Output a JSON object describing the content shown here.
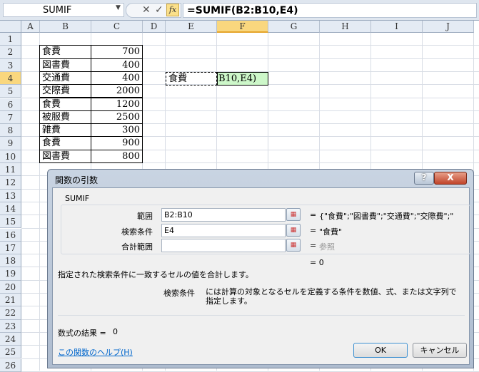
{
  "formula_bar": {
    "name_box": "SUMIF",
    "cancel_icon": "✕",
    "enter_icon": "✓",
    "fx": "fx",
    "formula": "=SUMIF(B2:B10,E4)"
  },
  "columns": [
    "A",
    "B",
    "C",
    "D",
    "E",
    "F",
    "G",
    "H",
    "I",
    "J"
  ],
  "selected_column": "F",
  "rows": [
    "1",
    "2",
    "3",
    "4",
    "5",
    "6",
    "7",
    "8",
    "9",
    "10",
    "11",
    "12",
    "13",
    "14",
    "15",
    "16",
    "17",
    "18",
    "19",
    "20",
    "21",
    "22",
    "23",
    "24",
    "25",
    "26"
  ],
  "selected_row": "4",
  "table": [
    {
      "item": "食費",
      "amount": "700"
    },
    {
      "item": "図書費",
      "amount": "400"
    },
    {
      "item": "交通費",
      "amount": "400"
    },
    {
      "item": "交際費",
      "amount": "2000"
    },
    {
      "item": "食費",
      "amount": "1200"
    },
    {
      "item": "被服費",
      "amount": "2500"
    },
    {
      "item": "雑費",
      "amount": "300"
    },
    {
      "item": "食費",
      "amount": "900"
    },
    {
      "item": "図書費",
      "amount": "800"
    }
  ],
  "cells": {
    "E4": "食費",
    "F4": "B10,E4)"
  },
  "dialog": {
    "title": "関数の引数",
    "help": "?",
    "close": "X",
    "function": "SUMIF",
    "args": [
      {
        "label": "範囲",
        "value": "B2:B10",
        "result": "{\"食費\";\"図書費\";\"交通費\";\"交際費\";\""
      },
      {
        "label": "検索条件",
        "value": "E4",
        "result": "\"食費\""
      },
      {
        "label": "合計範囲",
        "value": "",
        "result": "参照"
      }
    ],
    "eq": "=",
    "func_result": "= 0",
    "description": "指定された検索条件に一致するセルの値を合計します。",
    "arg_name": "検索条件",
    "arg_help": "には計算の対象となるセルを定義する条件を数値、式、または文字列で指定します。",
    "formula_result_label": "数式の結果 =",
    "formula_result": "0",
    "help_link": "この関数のヘルプ(H)",
    "ok": "OK",
    "cancel": "キャンセル"
  }
}
